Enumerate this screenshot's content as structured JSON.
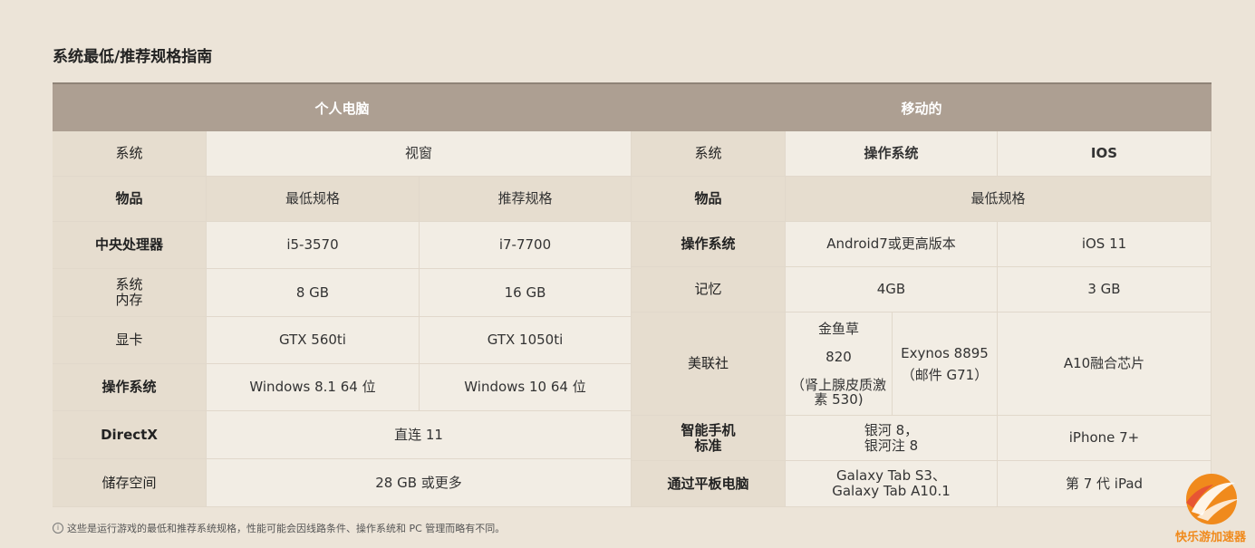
{
  "title": "系统最低/推荐规格指南",
  "pc": {
    "header": "个人电脑",
    "rows": [
      {
        "label": "系统",
        "value": "视窗"
      },
      {
        "label": "物品",
        "min": "最低规格",
        "rec": "推荐规格"
      },
      {
        "label": "中央处理器",
        "min": "i5-3570",
        "rec": "i7-7700"
      },
      {
        "label_line1": "系统",
        "label_line2": "内存",
        "min": "8 GB",
        "rec": "16 GB"
      },
      {
        "label": "显卡",
        "min": "GTX 560ti",
        "rec": "GTX 1050ti"
      },
      {
        "label": "操作系统",
        "min": "Windows 8.1 64 位",
        "rec": "Windows 10 64 位"
      },
      {
        "label": "DirectX",
        "value": "直连 11"
      },
      {
        "label": "储存空间",
        "value": "28 GB 或更多"
      }
    ]
  },
  "mobile": {
    "header": "移动的",
    "system": {
      "label": "系统",
      "android": "操作系统",
      "ios": "IOS"
    },
    "item": {
      "label": "物品",
      "value": "最低规格"
    },
    "os": {
      "label": "操作系统",
      "android": "Android7或更高版本",
      "ios": "iOS 11"
    },
    "memory": {
      "label": "记忆",
      "android": "4GB",
      "ios": "3 GB"
    },
    "ap": {
      "label": "美联社",
      "snap_1": "金鱼草",
      "snap_2": "820",
      "snap_3": "（肾上腺皮质激",
      "snap_4": "素 530)",
      "exynos_1": "Exynos 8895",
      "exynos_2": "（邮件 G71）",
      "ios": "A10融合芯片"
    },
    "phone": {
      "label_1": "智能手机",
      "label_2": "标准",
      "android_1": "银河 8，",
      "android_2": "银河注 8",
      "ios": "iPhone 7+"
    },
    "tablet": {
      "label": "通过平板电脑",
      "android_1": "Galaxy Tab S3、",
      "android_2": "Galaxy Tab A10.1",
      "ios": "第 7 代 iPad"
    }
  },
  "footnote": "这些是运行游戏的最低和推荐系统规格，性能可能会因线路条件、操作系统和 PC 管理而略有不同。",
  "watermark": {
    "text": "快乐游加速器",
    "colors": {
      "orange": "#f08a1c",
      "red": "#e5473a"
    }
  }
}
